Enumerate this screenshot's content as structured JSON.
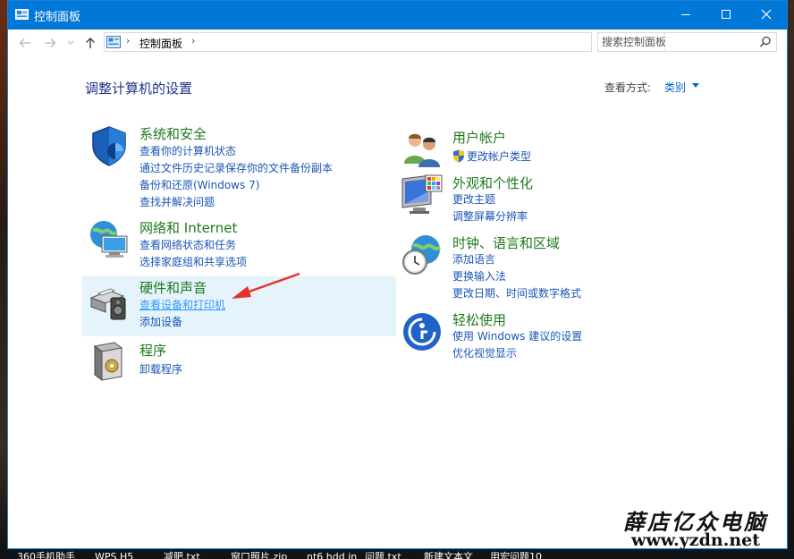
{
  "window": {
    "title": "控制面板"
  },
  "address": {
    "breadcrumb": "控制面板"
  },
  "search": {
    "placeholder": "搜索控制面板"
  },
  "page": {
    "heading": "调整计算机的设置",
    "viewby_label": "查看方式:",
    "viewby_value": "类别"
  },
  "categories": [
    {
      "title": "系统和安全",
      "icon": "shield-icon",
      "links": [
        "查看你的计算机状态",
        "通过文件历史记录保存你的文件备份副本",
        "备份和还原(Windows 7)",
        "查找并解决问题"
      ]
    },
    {
      "title": "网络和 Internet",
      "icon": "network-globe-icon",
      "links": [
        "查看网络状态和任务",
        "选择家庭组和共享选项"
      ]
    },
    {
      "title": "硬件和声音",
      "icon": "printer-speaker-icon",
      "links": [
        "查看设备和打印机",
        "添加设备"
      ]
    },
    {
      "title": "程序",
      "icon": "programs-box-icon",
      "links": [
        "卸载程序"
      ]
    },
    {
      "title": "用户帐户",
      "icon": "users-icon",
      "links": [
        "更改帐户类型"
      ]
    },
    {
      "title": "外观和个性化",
      "icon": "monitor-palette-icon",
      "links": [
        "更改主题",
        "调整屏幕分辨率"
      ]
    },
    {
      "title": "时钟、语言和区域",
      "icon": "clock-globe-icon",
      "links": [
        "添加语言",
        "更换输入法",
        "更改日期、时间或数字格式"
      ]
    },
    {
      "title": "轻松使用",
      "icon": "ease-of-access-icon",
      "links": [
        "使用 Windows 建议的设置",
        "优化视觉显示"
      ]
    }
  ],
  "taskbar": [
    "360手机助手",
    "WPS H5",
    "减肥.txt",
    "窗口照片.zip",
    "nt6 hdd in",
    "问题.txt",
    "新建文本文",
    "用宏问题10"
  ],
  "watermark": {
    "name": "薛店亿众电脑",
    "url": "www.yzdn.net"
  },
  "colors": {
    "titlebar": "#0078d7",
    "category_title": "#1e7a1e",
    "link": "#1a56b5",
    "heading": "#1e3287",
    "highlight": "#e5f3fb"
  }
}
